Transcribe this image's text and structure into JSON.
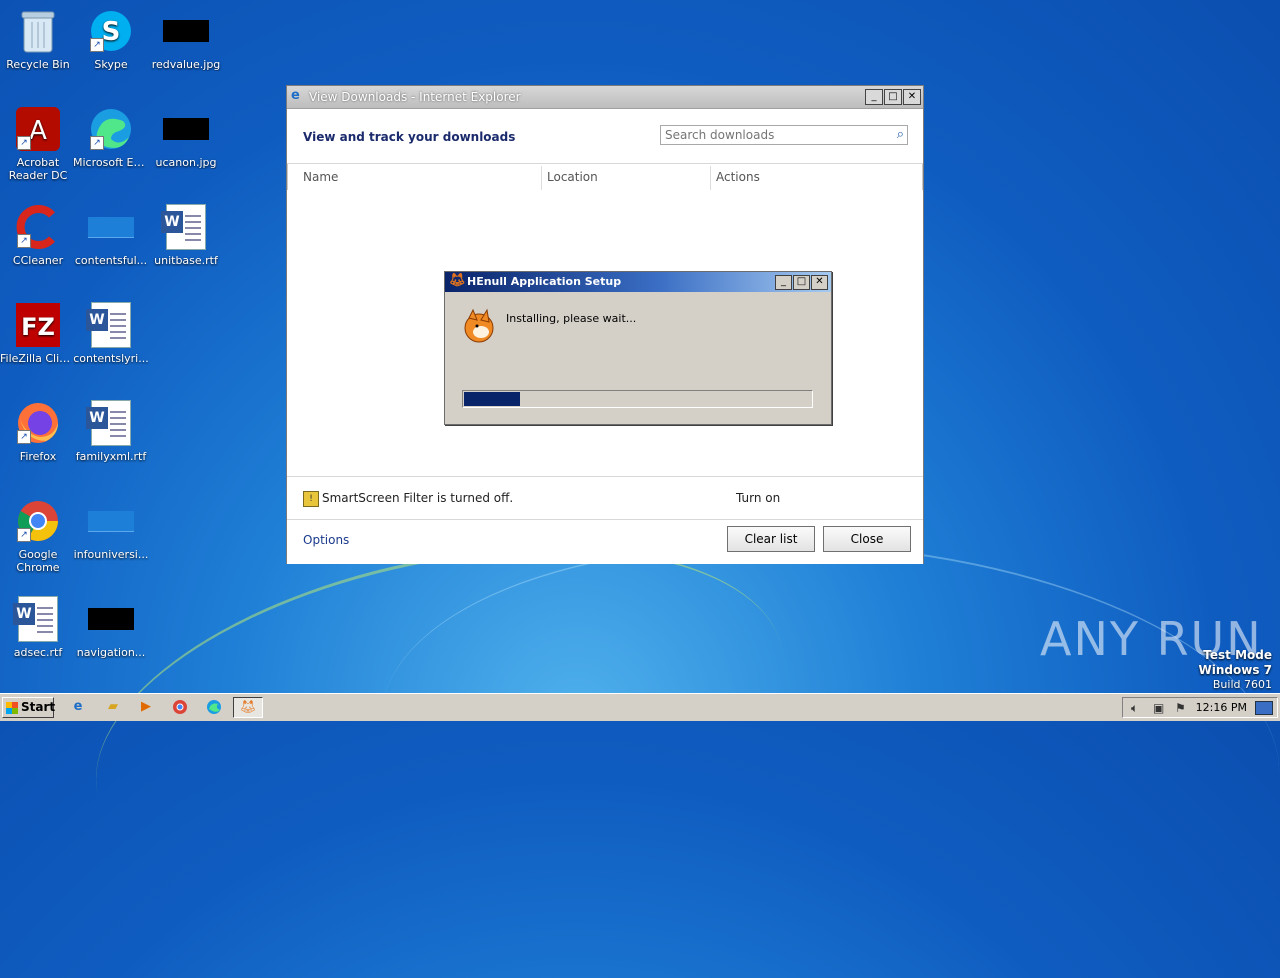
{
  "desktop": {
    "icons": [
      {
        "label": "Recycle Bin",
        "icon": "recycle-bin-icon"
      },
      {
        "label": "Skype",
        "icon": "skype-icon"
      },
      {
        "label": "redvalue.jpg",
        "icon": "image-file-icon"
      },
      {
        "label": "Acrobat Reader DC",
        "icon": "acrobat-icon"
      },
      {
        "label": "Microsoft Edge",
        "icon": "edge-icon"
      },
      {
        "label": "ucanon.jpg",
        "icon": "image-file-icon"
      },
      {
        "label": "CCleaner",
        "icon": "ccleaner-icon"
      },
      {
        "label": "contentsful...",
        "icon": "file-icon"
      },
      {
        "label": "unitbase.rtf",
        "icon": "word-doc-icon"
      },
      {
        "label": "FileZilla Client",
        "icon": "filezilla-icon"
      },
      {
        "label": "contentslyri...",
        "icon": "word-doc-icon"
      },
      {
        "label": "Firefox",
        "icon": "firefox-icon"
      },
      {
        "label": "familyxml.rtf",
        "icon": "word-doc-icon"
      },
      {
        "label": "Google Chrome",
        "icon": "chrome-icon"
      },
      {
        "label": "infouniversi...",
        "icon": "file-icon"
      },
      {
        "label": "adsec.rtf",
        "icon": "word-doc-icon"
      },
      {
        "label": "navigation...",
        "icon": "image-file-icon"
      }
    ]
  },
  "ie_window": {
    "title": "View Downloads - Internet Explorer",
    "heading": "View and track your downloads",
    "search_placeholder": "Search downloads",
    "columns": [
      "Name",
      "Location",
      "Actions"
    ],
    "smartscreen_message": "SmartScreen Filter is turned off.",
    "turn_on_label": "Turn on",
    "options_label": "Options",
    "clear_list_label": "Clear list",
    "close_label": "Close"
  },
  "setup_dialog": {
    "title": "HEnull Application Setup",
    "message": "Installing, please wait...",
    "progress": 0.16
  },
  "taskbar": {
    "start_label": "Start",
    "clock": "12:16 PM"
  },
  "watermark": {
    "line1": "Test Mode",
    "line2": "Windows 7",
    "line3": "Build 7601",
    "brand": "ANY RUN"
  },
  "colors": {
    "desktop_blue": "#0f5cc0",
    "dialog_title": "#0a246a",
    "progress_fill": "#0a246a"
  }
}
